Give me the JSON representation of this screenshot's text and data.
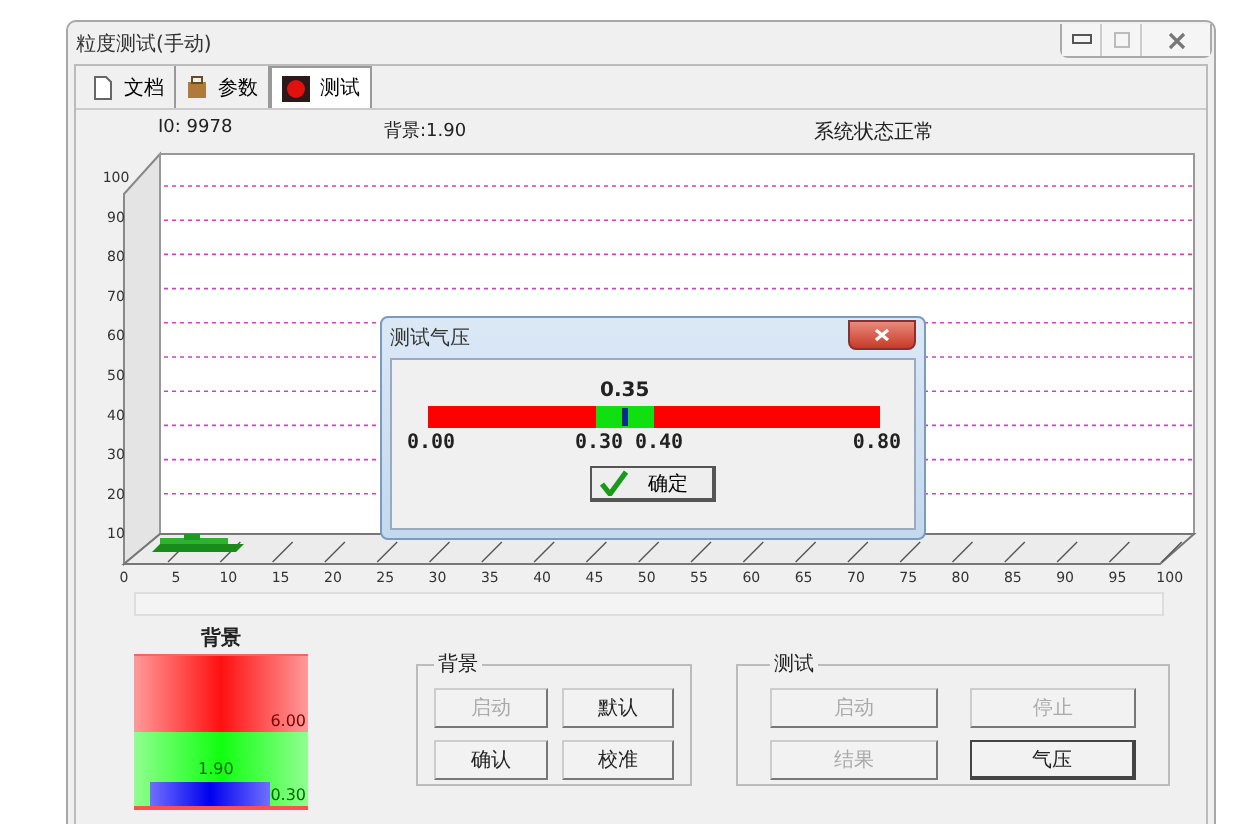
{
  "window": {
    "title": "粒度测试(手动)"
  },
  "tabs": [
    {
      "label": "文档",
      "kind": "document",
      "selected": false
    },
    {
      "label": "参数",
      "kind": "tool",
      "selected": false
    },
    {
      "label": "测试",
      "kind": "record",
      "selected": true
    }
  ],
  "info": {
    "io": "I0: 9978",
    "background": "背景:1.90",
    "status": "系统状态正常"
  },
  "chart": {
    "y_axis_labels": [
      "100",
      "90",
      "80",
      "70",
      "60",
      "50",
      "40",
      "30",
      "20",
      "10",
      "0"
    ],
    "x_axis_labels": [
      "5",
      "10",
      "15",
      "20",
      "25",
      "30",
      "35",
      "40",
      "45",
      "50",
      "55",
      "60",
      "65",
      "70",
      "75",
      "80",
      "85",
      "90",
      "95",
      "100"
    ]
  },
  "background_meter": {
    "title": "背景",
    "upper": "6.00",
    "value": "1.90",
    "lower": "0.30"
  },
  "background_group": {
    "title": "背景",
    "buttons": [
      {
        "label": "启动",
        "disabled": true,
        "focused": false
      },
      {
        "label": "默认",
        "disabled": false,
        "focused": false
      },
      {
        "label": "确认",
        "disabled": false,
        "focused": false
      },
      {
        "label": "校准",
        "disabled": false,
        "focused": false
      }
    ]
  },
  "test_group": {
    "title": "测试",
    "buttons": [
      {
        "label": "启动",
        "disabled": true,
        "focused": false
      },
      {
        "label": "停止",
        "disabled": true,
        "focused": false
      },
      {
        "label": "结果",
        "disabled": true,
        "focused": false
      },
      {
        "label": "气压",
        "disabled": false,
        "focused": true
      }
    ]
  },
  "dialog": {
    "title": "测试气压",
    "reading": "0.35",
    "level": 0.4375,
    "min": "0.00",
    "band_low": "0.30",
    "band_high": "0.40",
    "max": "0.80",
    "ok_button": "确定"
  }
}
